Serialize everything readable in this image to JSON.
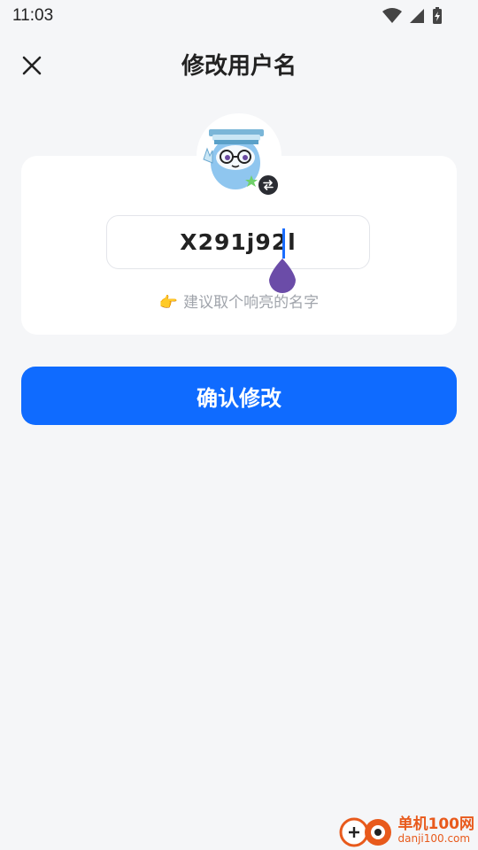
{
  "status_bar": {
    "time": "11:03"
  },
  "header": {
    "title": "修改用户名"
  },
  "username_input": {
    "value": "X291j92l"
  },
  "hint": {
    "emoji": "👉",
    "text": "建议取个响亮的名字"
  },
  "confirm_button": {
    "label": "确认修改"
  },
  "watermark": {
    "title": "单机100网",
    "url": "danji100.com"
  },
  "colors": {
    "accent": "#0f6bff",
    "background": "#f5f6f8",
    "handle": "#6b4ca8"
  }
}
